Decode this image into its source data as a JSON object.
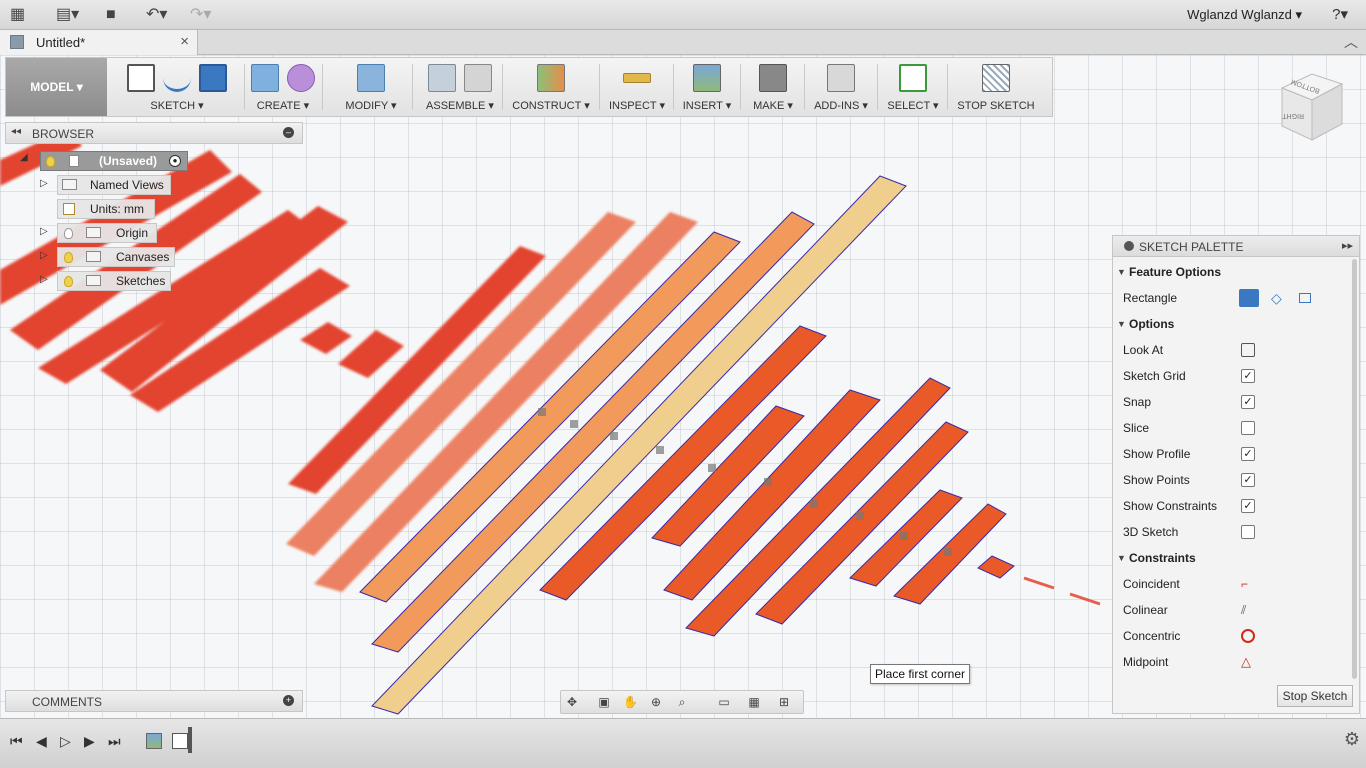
{
  "app": {
    "user_label": "Wglanzd Wglanzd",
    "help_glyph": "?",
    "document_tab": "Untitled*"
  },
  "toolbar": {
    "mode_label": "MODEL",
    "groups": [
      {
        "label": "SKETCH"
      },
      {
        "label": "CREATE"
      },
      {
        "label": "MODIFY"
      },
      {
        "label": "ASSEMBLE"
      },
      {
        "label": "CONSTRUCT"
      },
      {
        "label": "INSPECT"
      },
      {
        "label": "INSERT"
      },
      {
        "label": "MAKE"
      },
      {
        "label": "ADD-INS"
      },
      {
        "label": "SELECT"
      },
      {
        "label": "STOP SKETCH"
      }
    ]
  },
  "browser": {
    "title": "BROWSER",
    "root": "(Unsaved)",
    "items": [
      "Named Views",
      "Units: mm",
      "Origin",
      "Canvases",
      "Sketches"
    ]
  },
  "comments": {
    "title": "COMMENTS"
  },
  "palette": {
    "title": "SKETCH PALETTE",
    "sections": {
      "feature_options": "Feature Options",
      "options": "Options",
      "constraints": "Constraints"
    },
    "rectangle_label": "Rectangle",
    "look_at": "Look At",
    "options": [
      {
        "label": "Sketch Grid",
        "checked": true
      },
      {
        "label": "Snap",
        "checked": true
      },
      {
        "label": "Slice",
        "checked": false
      },
      {
        "label": "Show Profile",
        "checked": true
      },
      {
        "label": "Show Points",
        "checked": true
      },
      {
        "label": "Show Constraints",
        "checked": true
      },
      {
        "label": "3D Sketch",
        "checked": false
      }
    ],
    "constraints": [
      "Coincident",
      "Colinear",
      "Concentric",
      "Midpoint"
    ],
    "stop_button": "Stop Sketch"
  },
  "tooltip": "Place first corner",
  "viewcube": {
    "top": "BOTTOM",
    "front": "RIGHT"
  },
  "colors": {
    "accent": "#3a78c2",
    "strip_red": "#e23a25",
    "strip_orange": "#ea5a28",
    "strip_peach": "#f29a5c",
    "strip_cream": "#f0cf8e",
    "constraint_red": "#d12a1c"
  }
}
